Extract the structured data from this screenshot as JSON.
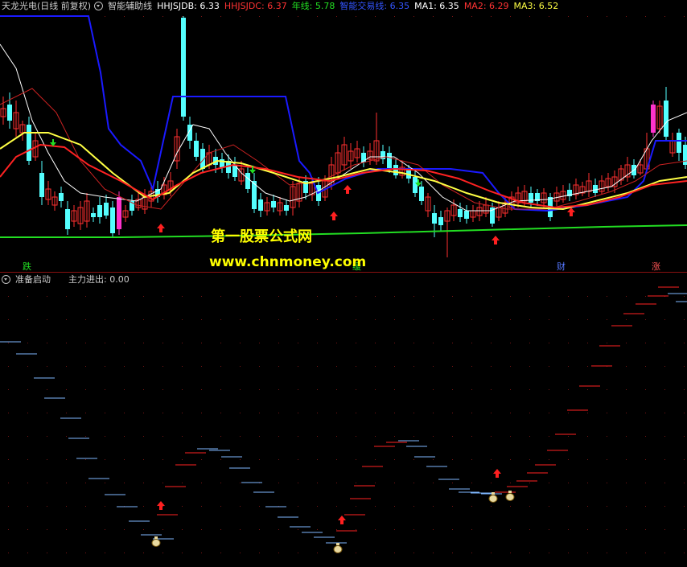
{
  "header": {
    "stock_title": "天龙光电(日线 前复权)",
    "indicator_name": "智能辅助线",
    "hhjsjdb_label": "HHJSJDB: 6.33",
    "hhjsjdc_label": "HHJSJDC: 6.37",
    "annual_line_label": "年线: 5.78",
    "smart_line_label": "智能交易线: 6.35",
    "ma1_label": "MA1: 6.35",
    "ma2_label": "MA2: 6.29",
    "ma3_label": "MA3: 6.52"
  },
  "sub_header": {
    "indicator_name": "准备启动",
    "main_flow_label": "主力进出: 0.00"
  },
  "markers": {
    "die": "跌",
    "huan": "缓",
    "cai": "财",
    "zhang": "涨"
  },
  "watermark": {
    "line1": "第一股票公式网",
    "line2": "www.chnmoney.com"
  },
  "colors": {
    "background": "#000000",
    "up_candle": "#ff3030",
    "down_candle": "#54ffff",
    "limit_up_candle": "#ff33cc",
    "smart_line": "#1a1aff",
    "annual_line": "#22dd22",
    "ma1": "#ffffff",
    "ma2": "#ff2222",
    "ma3": "#ffff44",
    "watermark": "#ffff00"
  }
}
